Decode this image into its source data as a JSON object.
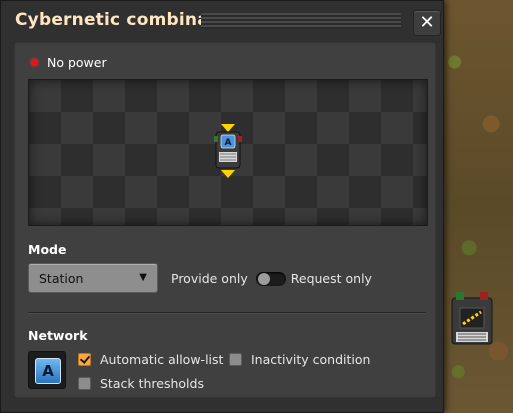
{
  "window": {
    "title": "Cybernetic combinator",
    "close_label": "✕"
  },
  "status": {
    "text": "No power",
    "color": "#e01818"
  },
  "preview": {
    "signal_letter": "A"
  },
  "mode": {
    "heading": "Mode",
    "selected": "Station",
    "switch_left": "Provide only",
    "switch_right": "Request only",
    "switch_state": "left"
  },
  "network": {
    "heading": "Network",
    "signal_letter": "A",
    "options": {
      "auto_allow": {
        "label": "Automatic allow-list",
        "checked": true
      },
      "inactivity": {
        "label": "Inactivity condition",
        "checked": false
      },
      "stack_thresholds": {
        "label": "Stack thresholds",
        "checked": false
      }
    }
  },
  "colors": {
    "accent": "#ffa640",
    "title": "#ffe6c0",
    "network_signal": "#4a94dc"
  }
}
